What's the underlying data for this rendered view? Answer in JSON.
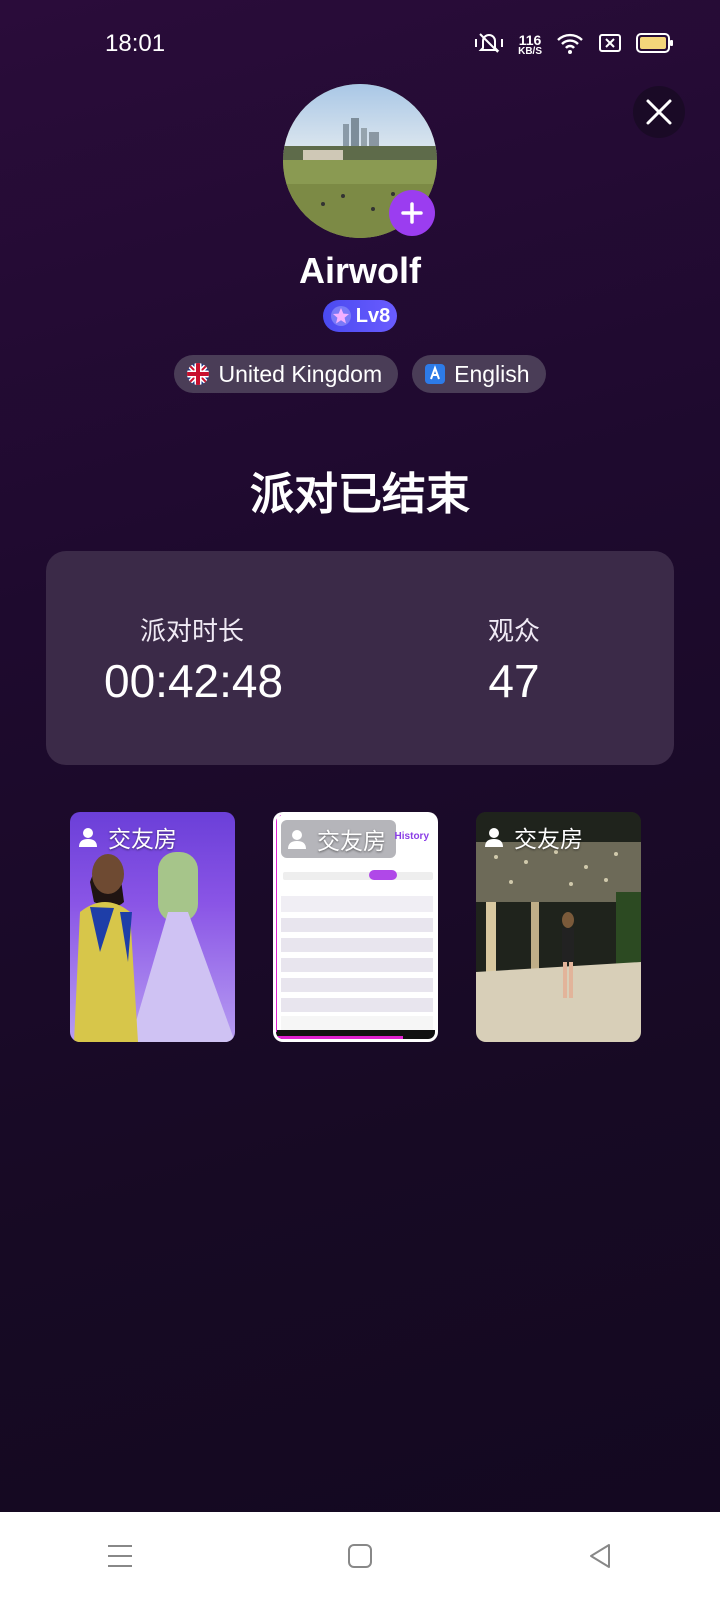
{
  "status": {
    "time": "18:01",
    "speed_value": "116",
    "speed_unit": "KB/S",
    "icons": [
      "mute-icon",
      "wifi-icon",
      "sim-off-icon",
      "battery-icon"
    ]
  },
  "profile": {
    "name": "Airwolf",
    "level": "Lv8",
    "country": "United Kingdom",
    "language": "English"
  },
  "title": "派对已结束",
  "stats": {
    "duration_label": "派对时长",
    "duration_value": "00:42:48",
    "audience_label": "观众",
    "audience_value": "47"
  },
  "rooms": [
    {
      "label": "交友房"
    },
    {
      "label": "交友房",
      "history": "History"
    },
    {
      "label": "交友房"
    }
  ],
  "colors": {
    "accent": "#9b3df0",
    "level": "#5a54f5",
    "card": "#3b2a48",
    "highlight": "#e020d0"
  }
}
